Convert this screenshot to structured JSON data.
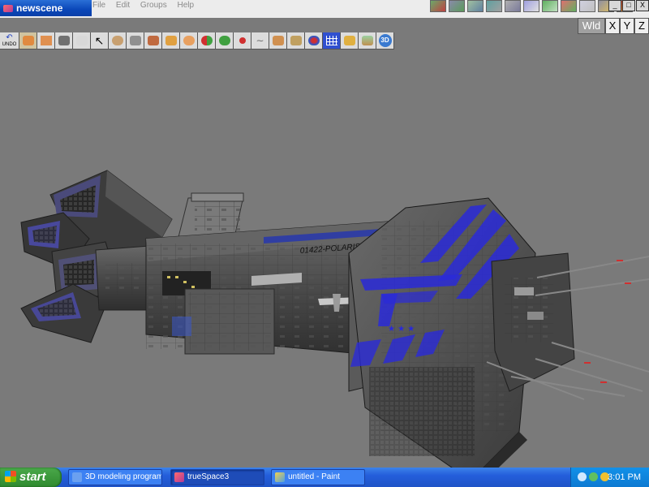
{
  "window": {
    "title": "newscene"
  },
  "menu": {
    "items": [
      "File",
      "Edit",
      "Groups",
      "Help"
    ]
  },
  "window_controls": {
    "minimize": "_",
    "restore": "□",
    "close": "X"
  },
  "axis": {
    "space_label": "Wld",
    "x": "X",
    "y": "Y",
    "z": "Z"
  },
  "toolbar": {
    "undo_label": "UNDO",
    "view3d_label": "3D"
  },
  "model": {
    "hull_text": "01422-POLARIS-2372",
    "colors": {
      "hull": "#5e5e5e",
      "accent": "#2a2ad8",
      "background": "#7a7a7a"
    }
  },
  "taskbar": {
    "start_label": "start",
    "tasks": [
      "3D modeling program...",
      "trueSpace3",
      "untitled - Paint"
    ],
    "clock": "3:01 PM"
  }
}
